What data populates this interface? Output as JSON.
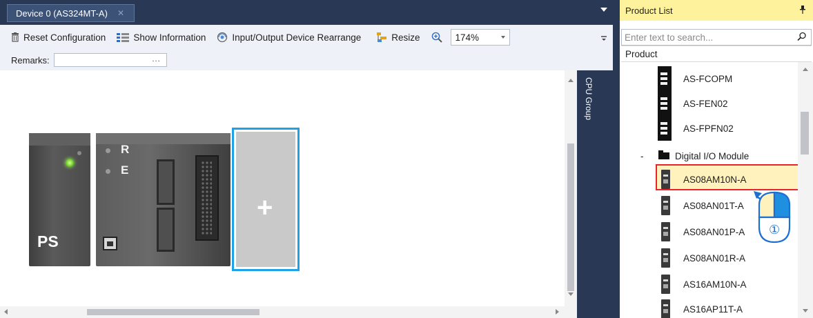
{
  "document": {
    "tab_title": "Device 0 (AS324MT-A)",
    "tab_close": "✕"
  },
  "toolbar": {
    "reset": "Reset Configuration",
    "show_info": "Show Information",
    "rearrange": "Input/Output Device Rearrange",
    "resize": "Resize",
    "zoom_value": "174%"
  },
  "remarks": {
    "label": "Remarks:",
    "value": "",
    "browse": "..."
  },
  "canvas": {
    "ps_label": "PS",
    "cpu_led_r": "R",
    "cpu_led_e": "E",
    "add_symbol": "+"
  },
  "cpu_group": {
    "label": "CPU Group"
  },
  "product_list": {
    "title": "Product List",
    "search_placeholder": "Enter text to search...",
    "column": "Product",
    "network_items": [
      "AS-FCOPM",
      "AS-FEN02",
      "AS-FPFN02"
    ],
    "category": {
      "toggle": "-",
      "label": "Digital I/O Module"
    },
    "digital_items": [
      "AS08AM10N-A",
      "AS08AN01T-A",
      "AS08AN01P-A",
      "AS08AN01R-A",
      "AS16AM10N-A",
      "AS16AP11T-A"
    ],
    "selected": "AS08AM10N-A"
  },
  "annotation": {
    "step": "①"
  },
  "colors": {
    "title_bar": "#293955",
    "toolbar_bg": "#eef1f7",
    "product_header": "#fff29d",
    "selection_border": "#e8242a",
    "selection_fill": "#fff2bd",
    "add_slot_border": "#1ea1e6"
  }
}
